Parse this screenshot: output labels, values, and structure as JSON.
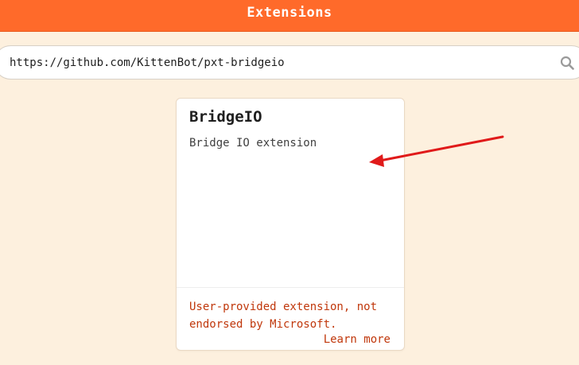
{
  "header": {
    "title": "Extensions"
  },
  "search": {
    "value": "https://github.com/KittenBot/pxt-bridgeio"
  },
  "icons": {
    "search": "search-icon",
    "annotation": "red-arrow-icon"
  },
  "card": {
    "title": "BridgeIO",
    "description": "Bridge IO extension",
    "warning": "User-provided extension, not endorsed by Microsoft.",
    "learn_more": "Learn more"
  },
  "colors": {
    "header_bg": "#ff6a2a",
    "page_bg": "#fdf0de",
    "warning_text": "#c0370b",
    "annotation_arrow": "#e01a1a"
  }
}
